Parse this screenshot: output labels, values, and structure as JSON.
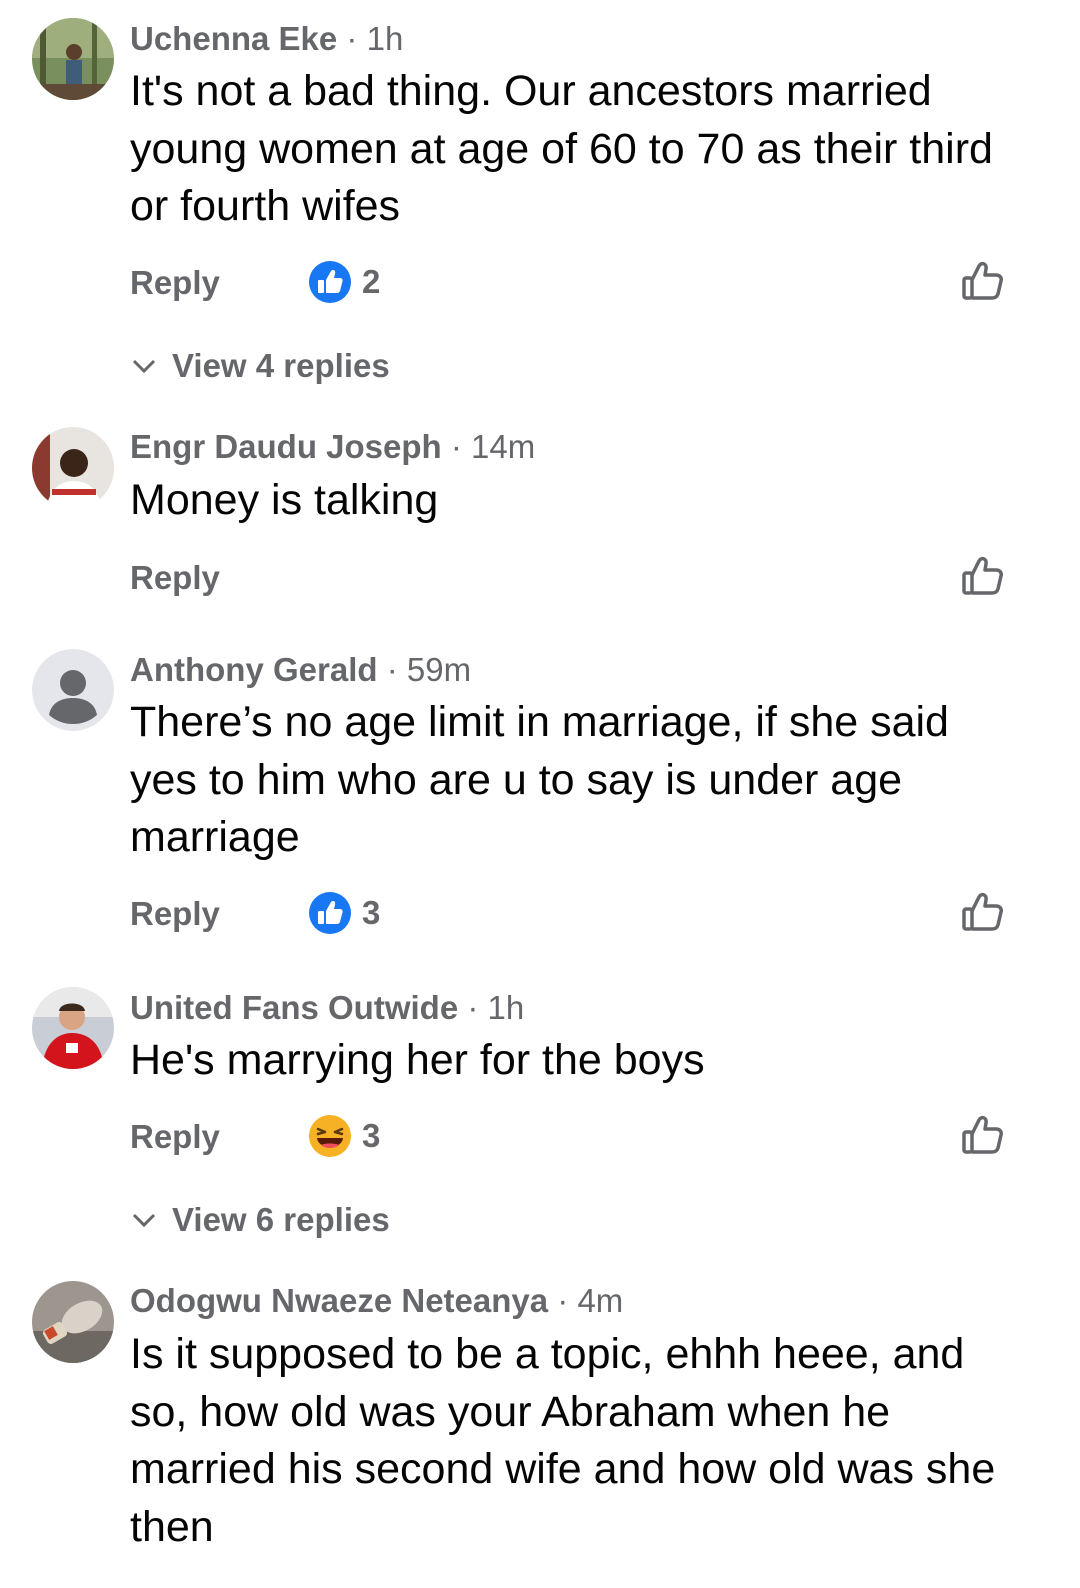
{
  "comments": [
    {
      "author": "Uchenna Eke",
      "separator": "·",
      "time": "1h",
      "text": "It's not a bad thing. Our ancestors married young women at age of 60 to 70 as their third or fourth wifes",
      "reply_label": "Reply",
      "reaction": {
        "type": "like",
        "count": "2"
      },
      "view_replies": "View 4 replies"
    },
    {
      "author": "Engr Daudu Joseph",
      "separator": "·",
      "time": "14m",
      "text": "Money is talking",
      "reply_label": "Reply"
    },
    {
      "author": "Anthony Gerald",
      "separator": "·",
      "time": "59m",
      "text": "There’s no age limit in marriage, if she said yes to him who are u to say is under age marriage",
      "reply_label": "Reply",
      "reaction": {
        "type": "like",
        "count": "3"
      }
    },
    {
      "author": "United Fans Outwide",
      "separator": "·",
      "time": "1h",
      "text": "He's marrying her for the boys",
      "reply_label": "Reply",
      "reaction": {
        "type": "haha",
        "count": "3"
      },
      "view_replies": "View 6 replies"
    },
    {
      "author": "Odogwu Nwaeze Neteanya",
      "separator": "·",
      "time": "4m",
      "text": "Is it supposed to be a topic, ehhh heee, and so, how old was your Abraham when he married his second wife and how old was she then"
    }
  ],
  "colors": {
    "secondary_text": "#65676b",
    "primary_text": "#050505",
    "like_blue": "#1877f2",
    "haha_yellow": "#f7b125"
  },
  "icons": {
    "like_reaction": "like-reaction-icon",
    "haha_reaction": "haha-reaction-icon",
    "like_button": "thumbs-up-outline-icon",
    "chevron": "chevron-down-icon",
    "default_avatar": "person-silhouette-icon"
  }
}
